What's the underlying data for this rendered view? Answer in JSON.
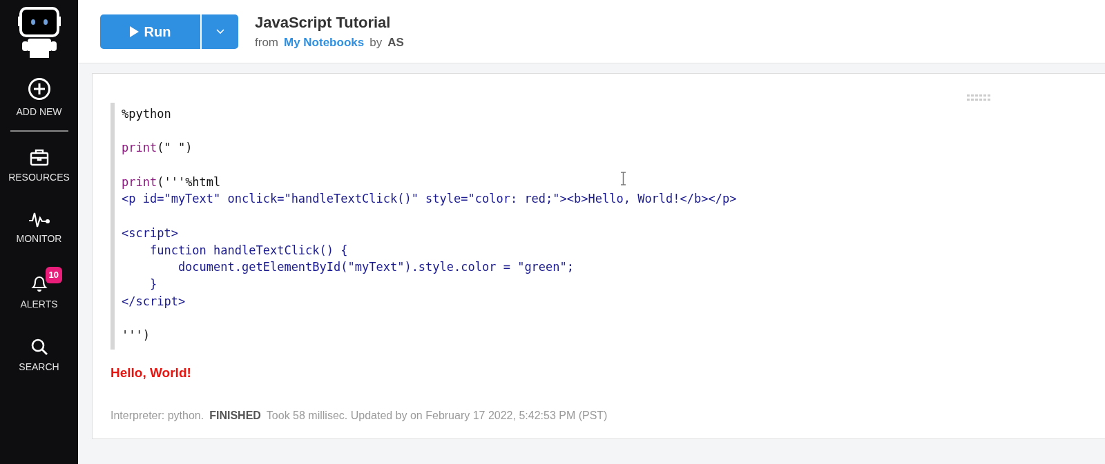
{
  "sidebar": {
    "items": [
      {
        "label": "ADD NEW"
      },
      {
        "label": "RESOURCES"
      },
      {
        "label": "MONITOR"
      },
      {
        "label": "ALERTS",
        "badge": "10"
      },
      {
        "label": "SEARCH"
      }
    ]
  },
  "toolbar": {
    "run_button": "Run"
  },
  "notebook": {
    "title": "JavaScript Tutorial",
    "from_label": "from",
    "folder_link": "My Notebooks",
    "by_label": "by",
    "author": "AS"
  },
  "paragraph": {
    "code_lines": [
      {
        "kind": "code",
        "segments": [
          {
            "kind": "plain",
            "text": "%python"
          }
        ]
      },
      {
        "kind": "blank"
      },
      {
        "kind": "code",
        "segments": [
          {
            "kind": "keyword",
            "text": "print"
          },
          {
            "kind": "plain",
            "text": "(\" \")"
          }
        ]
      },
      {
        "kind": "blank"
      },
      {
        "kind": "code",
        "segments": [
          {
            "kind": "keyword",
            "text": "print"
          },
          {
            "kind": "plain",
            "text": "('''%html"
          }
        ]
      },
      {
        "kind": "code",
        "segments": [
          {
            "kind": "markup",
            "text": "<p id=\"myText\" onclick=\"handleTextClick()\" style=\"color: red;\"><b>Hello, World!</b></p>"
          }
        ]
      },
      {
        "kind": "blank"
      },
      {
        "kind": "code",
        "segments": [
          {
            "kind": "markup",
            "text": "<script>"
          }
        ]
      },
      {
        "kind": "code",
        "segments": [
          {
            "kind": "markup",
            "text": "    function handleTextClick() {"
          }
        ]
      },
      {
        "kind": "code",
        "segments": [
          {
            "kind": "markup",
            "text": "        document.getElementById(\"myText\").style.color = \"green\";"
          }
        ]
      },
      {
        "kind": "code",
        "segments": [
          {
            "kind": "markup",
            "text": "    }"
          }
        ]
      },
      {
        "kind": "code",
        "segments": [
          {
            "kind": "markup",
            "text": "</script>"
          }
        ]
      },
      {
        "kind": "blank"
      },
      {
        "kind": "code",
        "segments": [
          {
            "kind": "plain",
            "text": "''')"
          }
        ]
      }
    ],
    "output": "Hello, World!",
    "status": {
      "interpreter": "Interpreter: python.",
      "state": "FINISHED",
      "details": "Took 58 millisec. Updated by on February 17 2022, 5:42:53 PM (PST)"
    }
  }
}
